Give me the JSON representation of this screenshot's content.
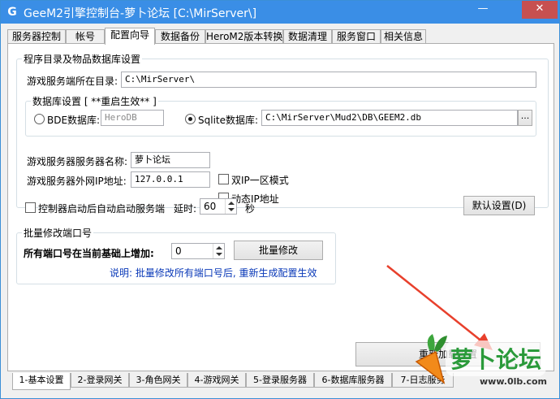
{
  "window": {
    "title": "GeeM2引擎控制台-萝卜论坛 [C:\\MirServer\\]",
    "app_icon": "G"
  },
  "tabs_top": [
    {
      "label": "服务器控制"
    },
    {
      "label": "帐号"
    },
    {
      "label": "配置向导"
    },
    {
      "label": "数据备份"
    },
    {
      "label": "HeroM2版本转换"
    },
    {
      "label": "数据清理"
    },
    {
      "label": "服务窗口"
    },
    {
      "label": "相关信息"
    }
  ],
  "group_paths": {
    "title": "程序目录及物品数据库设置",
    "server_dir_label": "游戏服务端所在目录:",
    "server_dir_value": "C:\\MirServer\\",
    "db_title": "数据库设置 [ **重启生效** ]",
    "bde_label": "BDE数据库:",
    "bde_value": "HeroDB",
    "sqlite_label": "Sqlite数据库:",
    "sqlite_value": "C:\\MirServer\\Mud2\\DB\\GEEM2.db",
    "browse_label": "..."
  },
  "server": {
    "name_label": "游戏服务器服务器名称:",
    "name_value": "萝卜论坛",
    "ip_label": "游戏服务器外网IP地址:",
    "ip_value": "127.0.0.1",
    "dual_ip_label": "双IP一区模式",
    "dynamic_ip_label": "动态IP地址",
    "autostart_label": "控制器启动后自动启动服务端",
    "delay_label": "延时:",
    "delay_value": "60",
    "delay_unit": "秒",
    "default_btn": "默认设置(D)"
  },
  "ports": {
    "title": "批量修改端口号",
    "increment_label": "所有端口号在当前基础上增加:",
    "increment_value": "0",
    "modify_btn": "批量修改",
    "note": "说明: 批量修改所有端口号后, 重新生成配置生效"
  },
  "reload_btn": "重新加载配置",
  "tabs_bottom": [
    {
      "label": "1-基本设置"
    },
    {
      "label": "2-登录网关"
    },
    {
      "label": "3-角色网关"
    },
    {
      "label": "4-游戏网关"
    },
    {
      "label": "5-登录服务器"
    },
    {
      "label": "6-数据库服务器"
    },
    {
      "label": "7-日志服务"
    }
  ],
  "watermark": {
    "logo_text": "萝卜论坛",
    "site": "www.0lb.com"
  },
  "colors": {
    "titlebar": "#3a8ee6",
    "arrow": "#e8402c",
    "note": "#0a39b8"
  }
}
